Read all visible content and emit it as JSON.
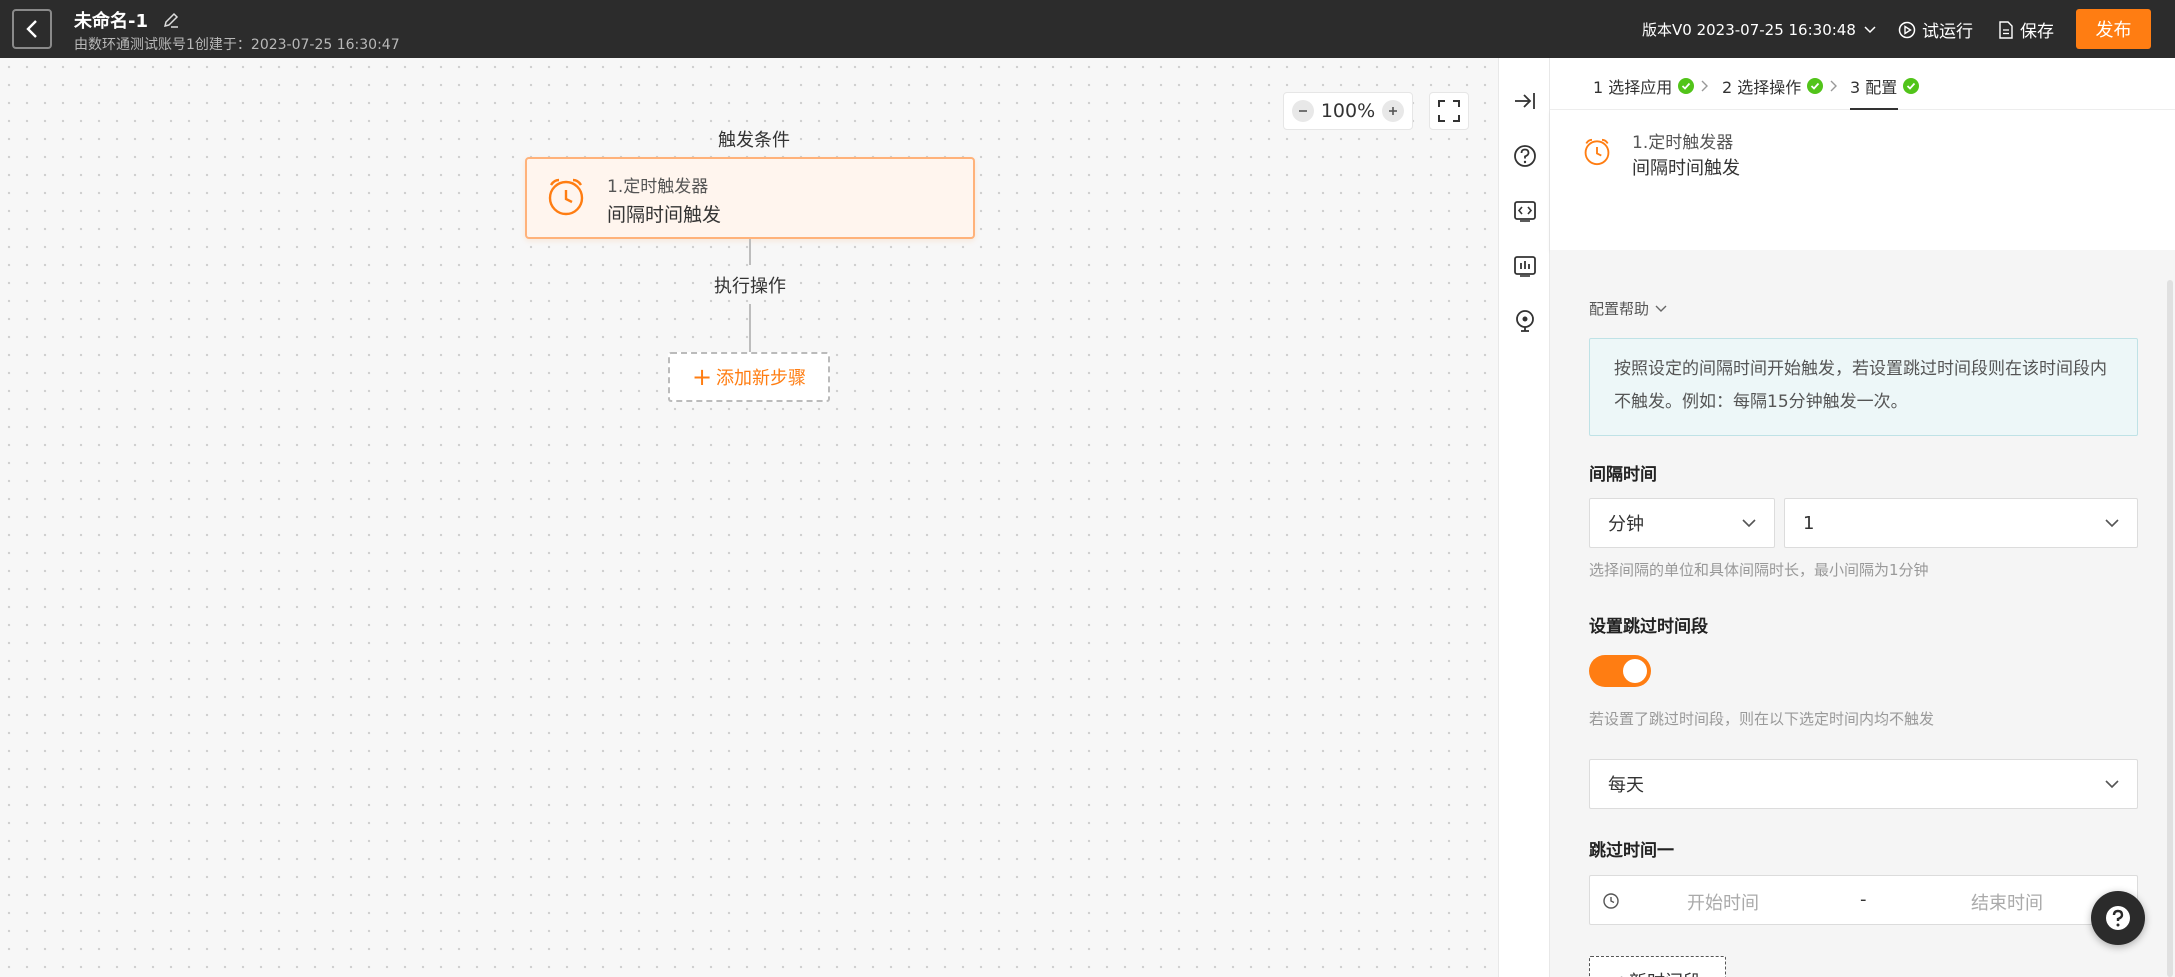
{
  "header": {
    "title": "未命名-1",
    "subtitle": "由数环通测试账号1创建于：2023-07-25 16:30:47",
    "version": "版本V0 2023-07-25 16:30:48",
    "test_run": "试运行",
    "save": "保存",
    "publish": "发布"
  },
  "canvas": {
    "zoom": "100%",
    "trigger_label": "触发条件",
    "trigger_node": {
      "title": "1.定时触发器",
      "subtitle": "间隔时间触发"
    },
    "exec_label": "执行操作",
    "add_step": "添加新步骤"
  },
  "panel": {
    "steps": [
      {
        "label": "1 选择应用"
      },
      {
        "label": "2 选择操作"
      },
      {
        "label": "3 配置"
      }
    ],
    "node_summary": {
      "title": "1.定时触发器",
      "subtitle": "间隔时间触发"
    },
    "help_toggle": "配置帮助",
    "help_text": "按照设定的间隔时间开始触发，若设置跳过时间段则在该时间段内不触发。例如：每隔15分钟触发一次。",
    "interval_label": "间隔时间",
    "interval_unit": "分钟",
    "interval_value": "1",
    "interval_hint": "选择间隔的单位和具体间隔时长，最小间隔为1分钟",
    "skip_label": "设置跳过时间段",
    "skip_hint": "若设置了跳过时间段，则在以下选定时间内均不触发",
    "frequency": "每天",
    "skip_period_label": "跳过时间一",
    "start_placeholder": "开始时间",
    "range_separator": "-",
    "end_placeholder": "结束时间",
    "add_period": "+新时间段"
  },
  "colors": {
    "accent": "#ff7d12",
    "header_bg": "#2c2c2c",
    "success": "#52c41a"
  }
}
